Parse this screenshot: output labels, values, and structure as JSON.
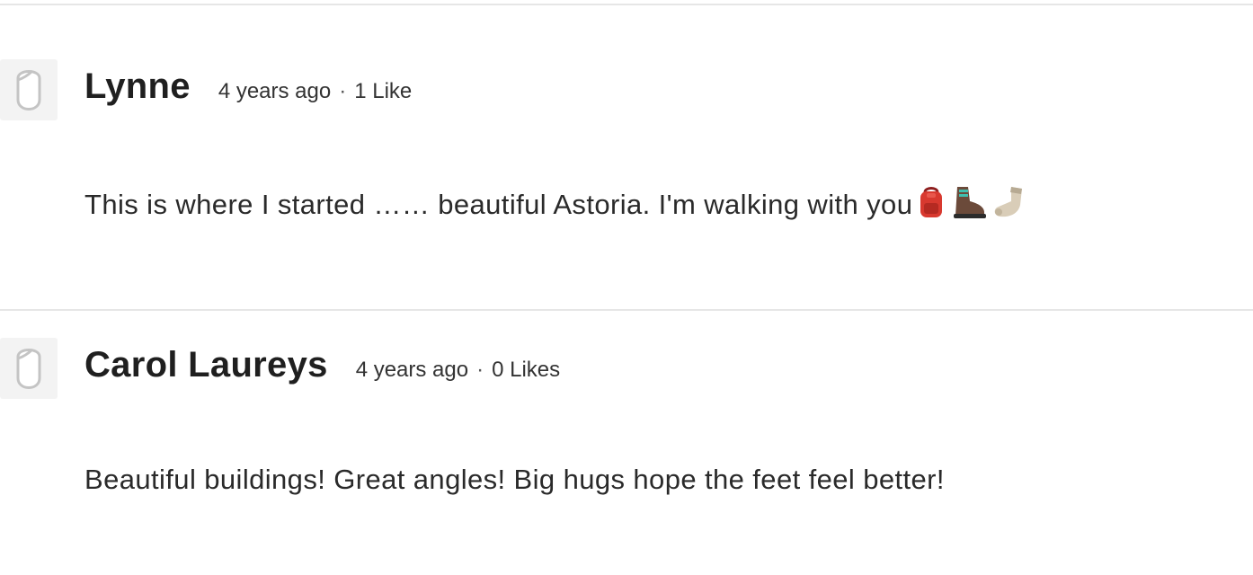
{
  "comments": [
    {
      "author": "Lynne",
      "time": "4 years ago",
      "separator": "·",
      "likes": "1 Like",
      "text": "This is where I started …… beautiful Astoria. I'm walking with you",
      "emojis": [
        "backpack-emoji",
        "hiking-boot-emoji",
        "sock-emoji"
      ]
    },
    {
      "author": "Carol Laureys",
      "time": "4 years ago",
      "separator": "·",
      "likes": "0 Likes",
      "text": "Beautiful buildings! Great angles! Big hugs hope the feet feel better!",
      "emojis": []
    }
  ],
  "colors": {
    "divider": "#e6e6e6",
    "avatar_bg": "#f3f3f3",
    "avatar_stroke": "#c4c4c4",
    "text": "#2a2a2a"
  },
  "icons": {
    "avatar": "default-avatar-icon"
  }
}
